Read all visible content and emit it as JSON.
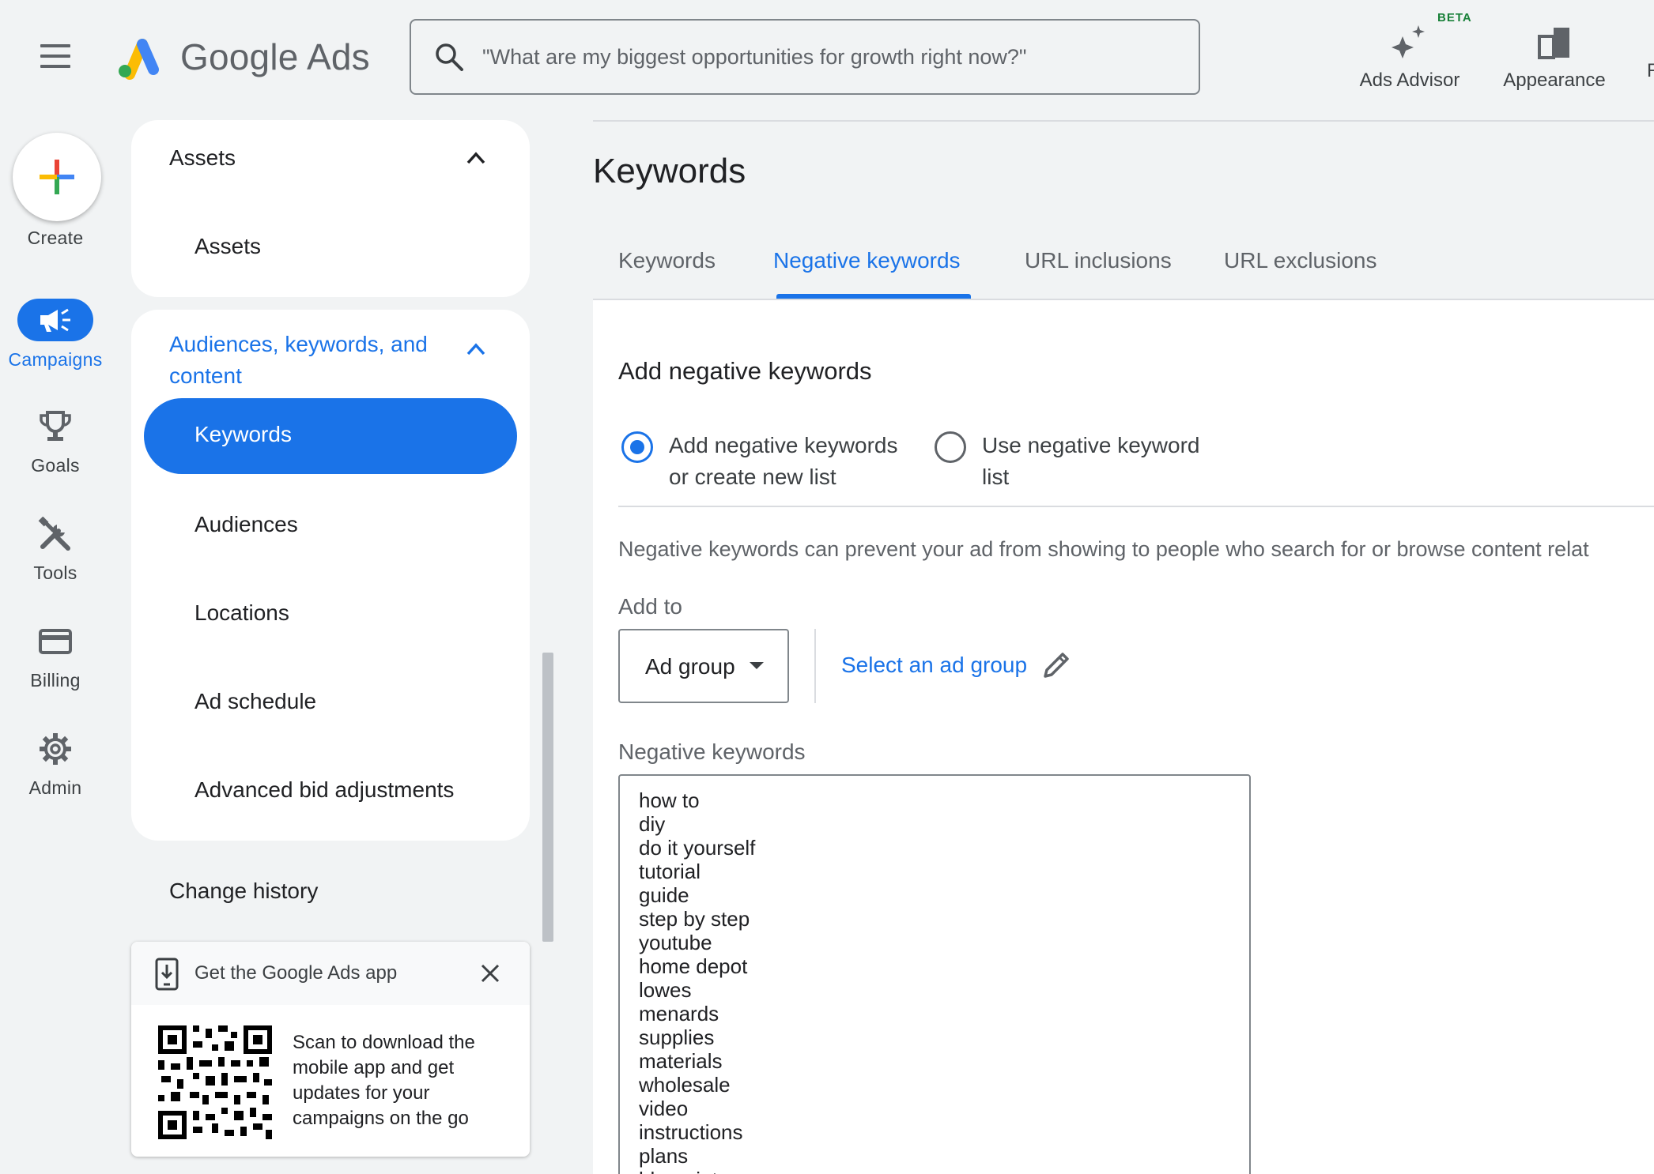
{
  "header": {
    "brand": "Google Ads",
    "search_placeholder": "\"What are my biggest opportunities for growth right now?\"",
    "actions": [
      {
        "label": "Ads Advisor",
        "badge": "BETA",
        "icon": "sparkle-icon"
      },
      {
        "label": "Appearance",
        "icon": "appearance-icon"
      }
    ],
    "truncated_action_letter": "R"
  },
  "rail": {
    "create": "Create",
    "items": [
      {
        "label": "Campaigns",
        "icon": "megaphone-icon",
        "active": true
      },
      {
        "label": "Goals",
        "icon": "trophy-icon"
      },
      {
        "label": "Tools",
        "icon": "tools-icon"
      },
      {
        "label": "Billing",
        "icon": "credit-card-icon"
      },
      {
        "label": "Admin",
        "icon": "gear-icon"
      }
    ]
  },
  "nav": {
    "assets_section": {
      "title": "Assets",
      "items": [
        "Assets"
      ]
    },
    "audiences_section": {
      "title_line1": "Audiences, keywords, and",
      "title_line2": "content",
      "items": [
        "Keywords",
        "Audiences",
        "Locations",
        "Ad schedule",
        "Advanced bid adjustments"
      ],
      "active": "Keywords"
    },
    "change_history": "Change history",
    "app_promo": {
      "title": "Get the Google Ads app",
      "body": "Scan to download the mobile app and get updates for your campaigns on the go"
    }
  },
  "main": {
    "title": "Keywords",
    "tabs": [
      "Keywords",
      "Negative keywords",
      "URL inclusions",
      "URL exclusions"
    ],
    "active_tab": "Negative keywords",
    "section_title": "Add negative keywords",
    "radio_options": [
      {
        "line1": "Add negative keywords",
        "line2": "or create new list",
        "selected": true
      },
      {
        "line1": "Use negative keyword",
        "line2": "list",
        "selected": false
      }
    ],
    "description": "Negative keywords can prevent your ad from showing to people who search for or browse content relat",
    "add_to_label": "Add to",
    "add_to_value": "Ad group",
    "select_link": "Select an ad group",
    "keywords_label": "Negative keywords",
    "keywords": [
      "how to",
      "diy",
      "do it yourself",
      "tutorial",
      "guide",
      "step by step",
      "youtube",
      "home depot",
      "lowes",
      "menards",
      "supplies",
      "materials",
      "wholesale",
      "video",
      "instructions",
      "plans",
      "blueprints"
    ]
  },
  "colors": {
    "accent": "#1a73e8",
    "background": "#f1f3f4",
    "text": "#202124",
    "muted": "#5f6368"
  }
}
